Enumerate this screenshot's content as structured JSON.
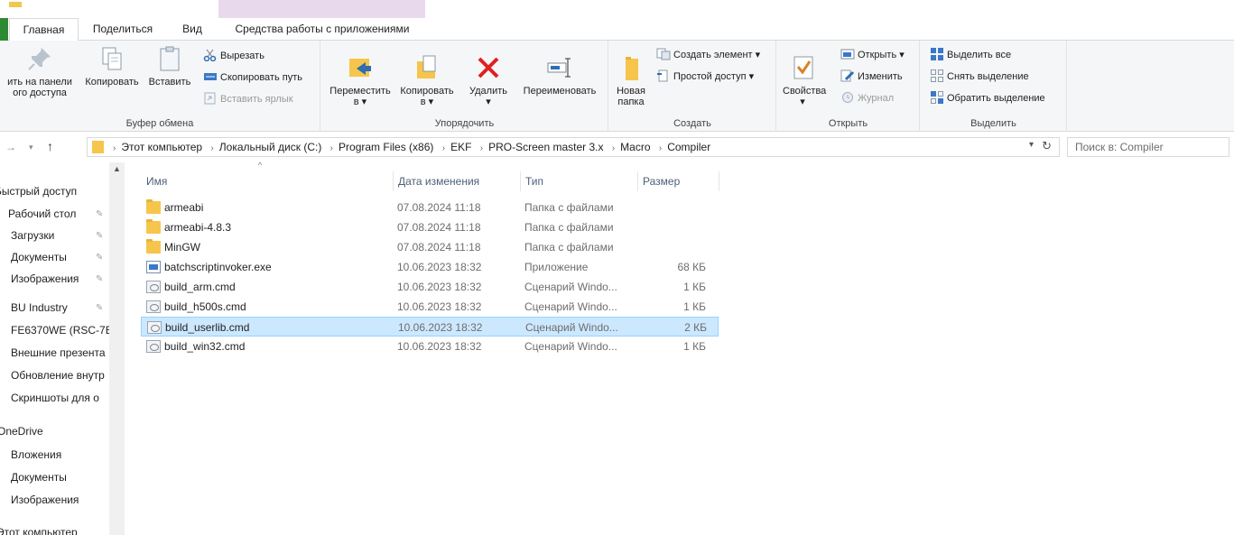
{
  "tabs": {
    "home": "Главная",
    "share": "Поделиться",
    "view": "Вид",
    "app_tools": "Средства работы с приложениями"
  },
  "ribbon": {
    "clipboard": {
      "label": "Буфер обмена",
      "pin_line1": "ить на панели",
      "pin_line2": "ого доступа",
      "copy": "Копировать",
      "paste": "Вставить",
      "cut": "Вырезать",
      "copy_path": "Скопировать путь",
      "paste_shortcut": "Вставить ярлык"
    },
    "organize": {
      "label": "Упорядочить",
      "move_to": "Переместить",
      "copy_to": "Копировать",
      "delete": "Удалить",
      "rename": "Переименовать",
      "dropdown": "в ▾"
    },
    "create": {
      "label": "Создать",
      "new_folder_line1": "Новая",
      "new_folder_line2": "папка",
      "new_item": "Создать элемент ▾",
      "easy_access": "Простой доступ ▾"
    },
    "open": {
      "label": "Открыть",
      "properties": "Свойства",
      "open": "Открыть ▾",
      "edit": "Изменить",
      "history": "Журнал"
    },
    "select": {
      "label": "Выделить",
      "select_all": "Выделить все",
      "select_none": "Снять выделение",
      "invert": "Обратить выделение"
    }
  },
  "address": {
    "crumbs": [
      "Этот компьютер",
      "Локальный диск (C:)",
      "Program Files (x86)",
      "EKF",
      "PRO-Screen master 3.x",
      "Macro",
      "Compiler"
    ],
    "search_placeholder": "Поиск в: Compiler"
  },
  "nav": {
    "quick_access": "Быстрый доступ",
    "items": [
      "Рабочий стол",
      "Загрузки",
      "Документы",
      "Изображения",
      "BU Industry",
      "FE6370WE (RSC-7E",
      "Внешние презента",
      "Обновление внутр",
      "Скриншоты для о"
    ],
    "onedrive": "OneDrive",
    "onedrive_items": [
      "Вложения",
      "Документы",
      "Изображения"
    ],
    "this_pc": "Этот компьютер"
  },
  "columns": {
    "name": "Имя",
    "date": "Дата изменения",
    "type": "Тип",
    "size": "Размер"
  },
  "files": [
    {
      "name": "armeabi",
      "date": "07.08.2024 11:18",
      "type": "Папка с файлами",
      "size": "",
      "icon": "folder-icon"
    },
    {
      "name": "armeabi-4.8.3",
      "date": "07.08.2024 11:18",
      "type": "Папка с файлами",
      "size": "",
      "icon": "folder-icon"
    },
    {
      "name": "MinGW",
      "date": "07.08.2024 11:18",
      "type": "Папка с файлами",
      "size": "",
      "icon": "folder-icon"
    },
    {
      "name": "batchscriptinvoker.exe",
      "date": "10.06.2023 18:32",
      "type": "Приложение",
      "size": "68 КБ",
      "icon": "exe-icon"
    },
    {
      "name": "build_arm.cmd",
      "date": "10.06.2023 18:32",
      "type": "Сценарий Windo...",
      "size": "1 КБ",
      "icon": "cmd-icon"
    },
    {
      "name": "build_h500s.cmd",
      "date": "10.06.2023 18:32",
      "type": "Сценарий Windo...",
      "size": "1 КБ",
      "icon": "cmd-icon"
    },
    {
      "name": "build_userlib.cmd",
      "date": "10.06.2023 18:32",
      "type": "Сценарий Windo...",
      "size": "2 КБ",
      "icon": "cmd-icon",
      "selected": true
    },
    {
      "name": "build_win32.cmd",
      "date": "10.06.2023 18:32",
      "type": "Сценарий Windo...",
      "size": "1 КБ",
      "icon": "cmd-icon"
    }
  ]
}
